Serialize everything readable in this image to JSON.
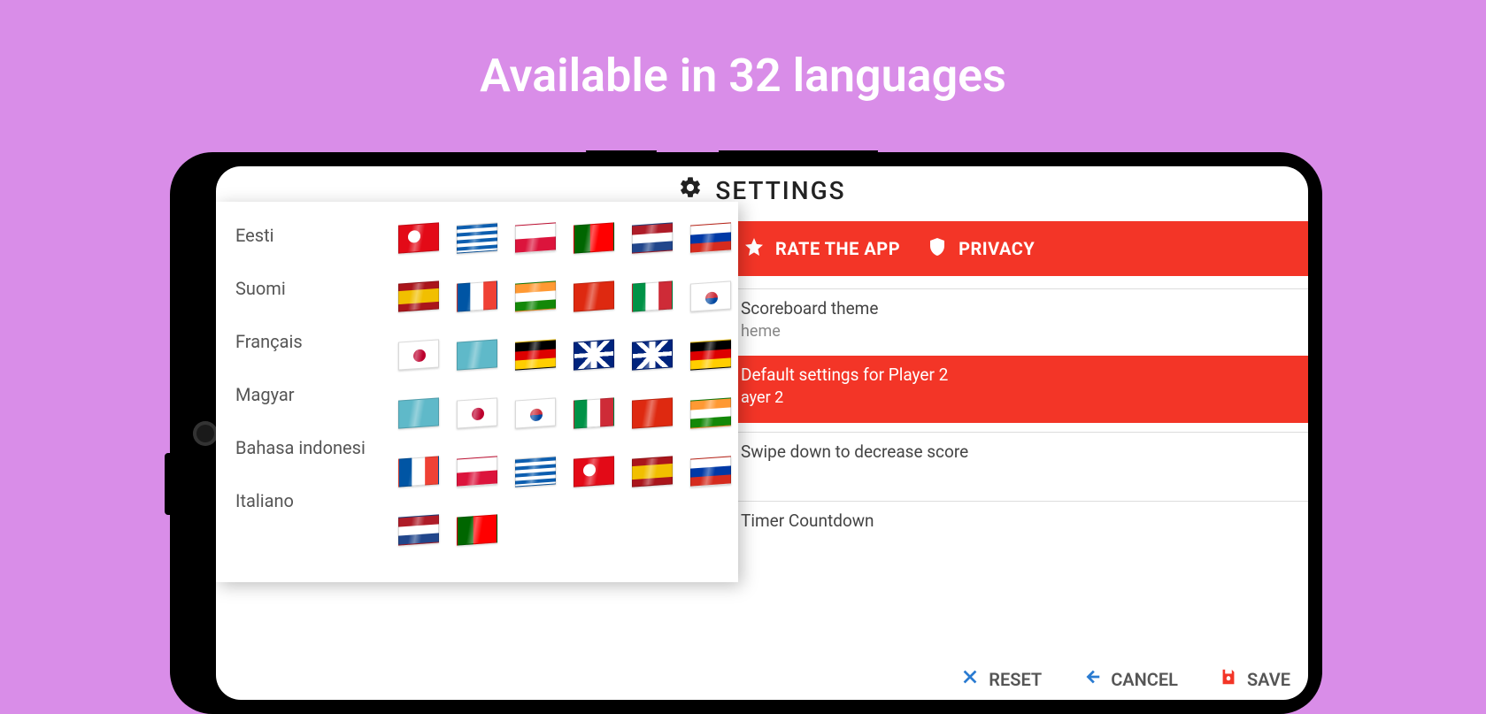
{
  "headline": "Available in 32 languages",
  "titlebar": {
    "label": "SETTINGS"
  },
  "redStrip": {
    "rate": "RATE THE APP",
    "privacy": "PRIVACY"
  },
  "settings": {
    "theme": {
      "label": "Scoreboard theme",
      "sub": "heme"
    },
    "player2": {
      "label": "Default settings for Player 2",
      "sub": "ayer 2"
    },
    "swipe": {
      "label": "Swipe down to decrease score"
    },
    "timer": {
      "label": "Timer Countdown"
    }
  },
  "footer": {
    "reset": "RESET",
    "cancel": "CANCEL",
    "save": "SAVE"
  },
  "popup": {
    "languages": [
      "Eesti",
      "Suomi",
      "Français",
      "Magyar",
      "Bahasa indonesi",
      "Italiano"
    ],
    "flagRows": [
      [
        "tr",
        "gr",
        "pl",
        "pt",
        "nl",
        "ru"
      ],
      [
        "es",
        "fr",
        "in",
        "cn",
        "it",
        "kr"
      ],
      [
        "jp",
        "wo",
        "de",
        "gb",
        "gb",
        "de"
      ],
      [
        "wo",
        "jp",
        "kr",
        "it",
        "cn",
        "in"
      ],
      [
        "fr",
        "pl",
        "gr",
        "tr",
        "es",
        "ru"
      ],
      [
        "nl",
        "pt"
      ]
    ]
  }
}
